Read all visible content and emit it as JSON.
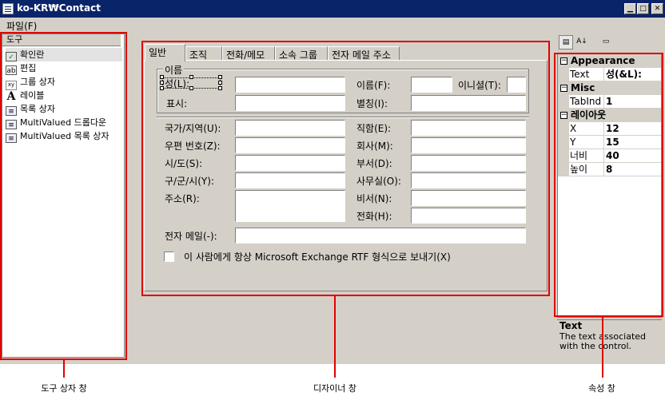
{
  "window": {
    "title": "ko-KR₩Contact",
    "buttons": [
      "minimize",
      "maximize",
      "close"
    ]
  },
  "menu": {
    "file": "파일(F)"
  },
  "toolbox": {
    "header": "도구",
    "items": [
      {
        "label": "확인란",
        "icon": "checkbox-icon"
      },
      {
        "label": "편집",
        "icon": "edit-icon"
      },
      {
        "label": "그룹 상자",
        "icon": "groupbox-icon"
      },
      {
        "label": "레이블",
        "icon": "label-icon"
      },
      {
        "label": "목록 상자",
        "icon": "listbox-icon"
      },
      {
        "label": "MultiValued 드롭다운",
        "icon": "multivalued-dropdown-icon"
      },
      {
        "label": "MultiValued 목록 상자",
        "icon": "multivalued-listbox-icon"
      }
    ]
  },
  "designer": {
    "tabs": [
      "일반",
      "조직",
      "전화/메모",
      "소속 그룹",
      "전자 메일 주소"
    ],
    "active_tab": 0,
    "group_name": "이름",
    "labels": {
      "last_name": "성(L):",
      "display": "표시:",
      "first_name": "이름(F):",
      "initials": "이니셜(T):",
      "alias": "별칭(I):",
      "country": "국가/지역(U):",
      "postal": "우편 번호(Z):",
      "state": "시/도(S):",
      "city": "구/군/시(Y):",
      "address": "주소(R):",
      "title": "직함(E):",
      "company": "회사(M):",
      "department": "부서(D):",
      "office": "사무실(O):",
      "assistant": "비서(N):",
      "phone": "전화(H):",
      "email": "전자 메일(-):"
    },
    "checkbox_label": "이 사람에게 항상 Microsoft Exchange RTF 형식으로 보내기(X)"
  },
  "properties": {
    "categories": [
      {
        "name": "Appearance",
        "rows": [
          {
            "name": "Text",
            "value": "성(&L):"
          }
        ]
      },
      {
        "name": "Misc",
        "rows": [
          {
            "name": "TabInd",
            "value": "1"
          }
        ]
      },
      {
        "name": "레이아웃",
        "rows": [
          {
            "name": "X",
            "value": "12"
          },
          {
            "name": "Y",
            "value": "15"
          },
          {
            "name": "너비",
            "value": "40"
          },
          {
            "name": "높이",
            "value": "8"
          }
        ]
      }
    ],
    "description_title": "Text",
    "description_body": "The text associated with the control."
  },
  "captions": {
    "toolbox": "도구 상자 창",
    "designer": "디자이너 창",
    "properties": "속성 창"
  },
  "colors": {
    "titlebar": "#0a246a",
    "face": "#d4d0c8",
    "highlight": "#e00000"
  }
}
